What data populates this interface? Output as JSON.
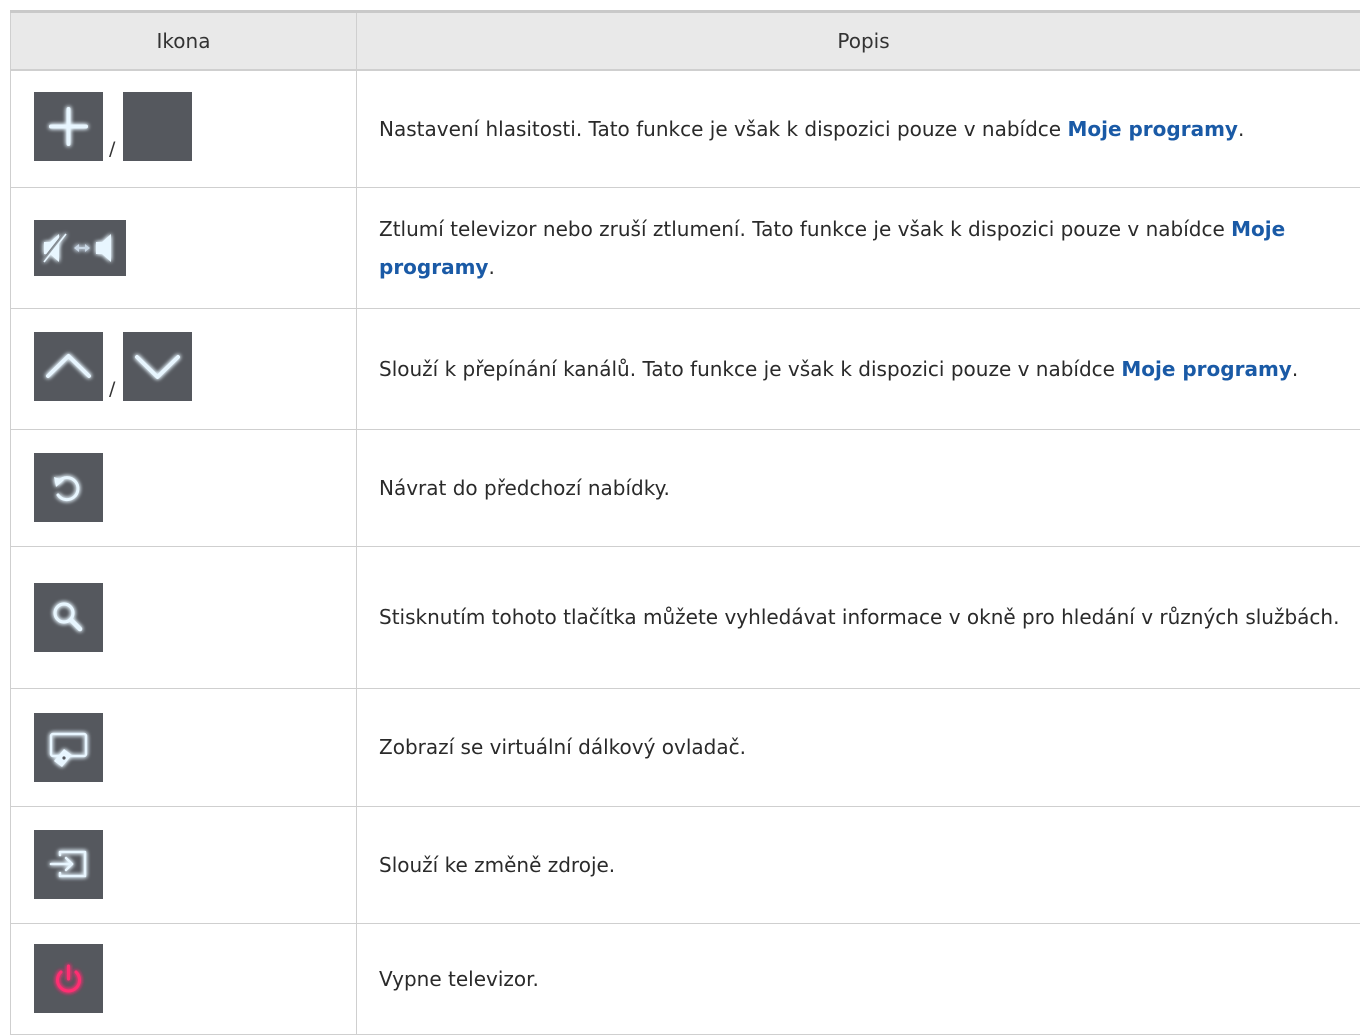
{
  "table": {
    "headers": {
      "icon": "Ikona",
      "description": "Popis"
    },
    "slash": "/",
    "rows": [
      {
        "icons": [
          "plus-icon",
          "minus-icon"
        ],
        "text": "Nastavení hlasitosti. Tato funkce je však k dispozici pouze v nabídce ",
        "bold": "Moje programy",
        "suffix": "."
      },
      {
        "icons": [
          "mute-toggle-icon"
        ],
        "text": "Ztlumí televizor nebo zruší ztlumení. Tato funkce je však k dispozici pouze v nabídce ",
        "bold": "Moje programy",
        "suffix": "."
      },
      {
        "icons": [
          "chevron-up-icon",
          "chevron-down-icon"
        ],
        "text": "Slouží k přepínání kanálů. Tato funkce je však k dispozici pouze v nabídce ",
        "bold": "Moje programy",
        "suffix": "."
      },
      {
        "icons": [
          "return-icon"
        ],
        "text": "Návrat do předchozí nabídky."
      },
      {
        "icons": [
          "search-icon"
        ],
        "text": "Stisknutím tohoto tlačítka můžete vyhledávat informace v okně pro hledání v různých službách."
      },
      {
        "icons": [
          "virtual-remote-icon"
        ],
        "text": "Zobrazí se virtuální dálkový ovladač."
      },
      {
        "icons": [
          "source-icon"
        ],
        "text": "Slouží ke změně zdroje."
      },
      {
        "icons": [
          "power-icon"
        ],
        "text": "Vypne televizor."
      }
    ]
  },
  "colors": {
    "icon_bg": "#55585e",
    "icon_glow": "#1aa0ff",
    "power": "#ff2f72",
    "link": "#1a5aa6",
    "header_bg": "#e9e9e9"
  }
}
